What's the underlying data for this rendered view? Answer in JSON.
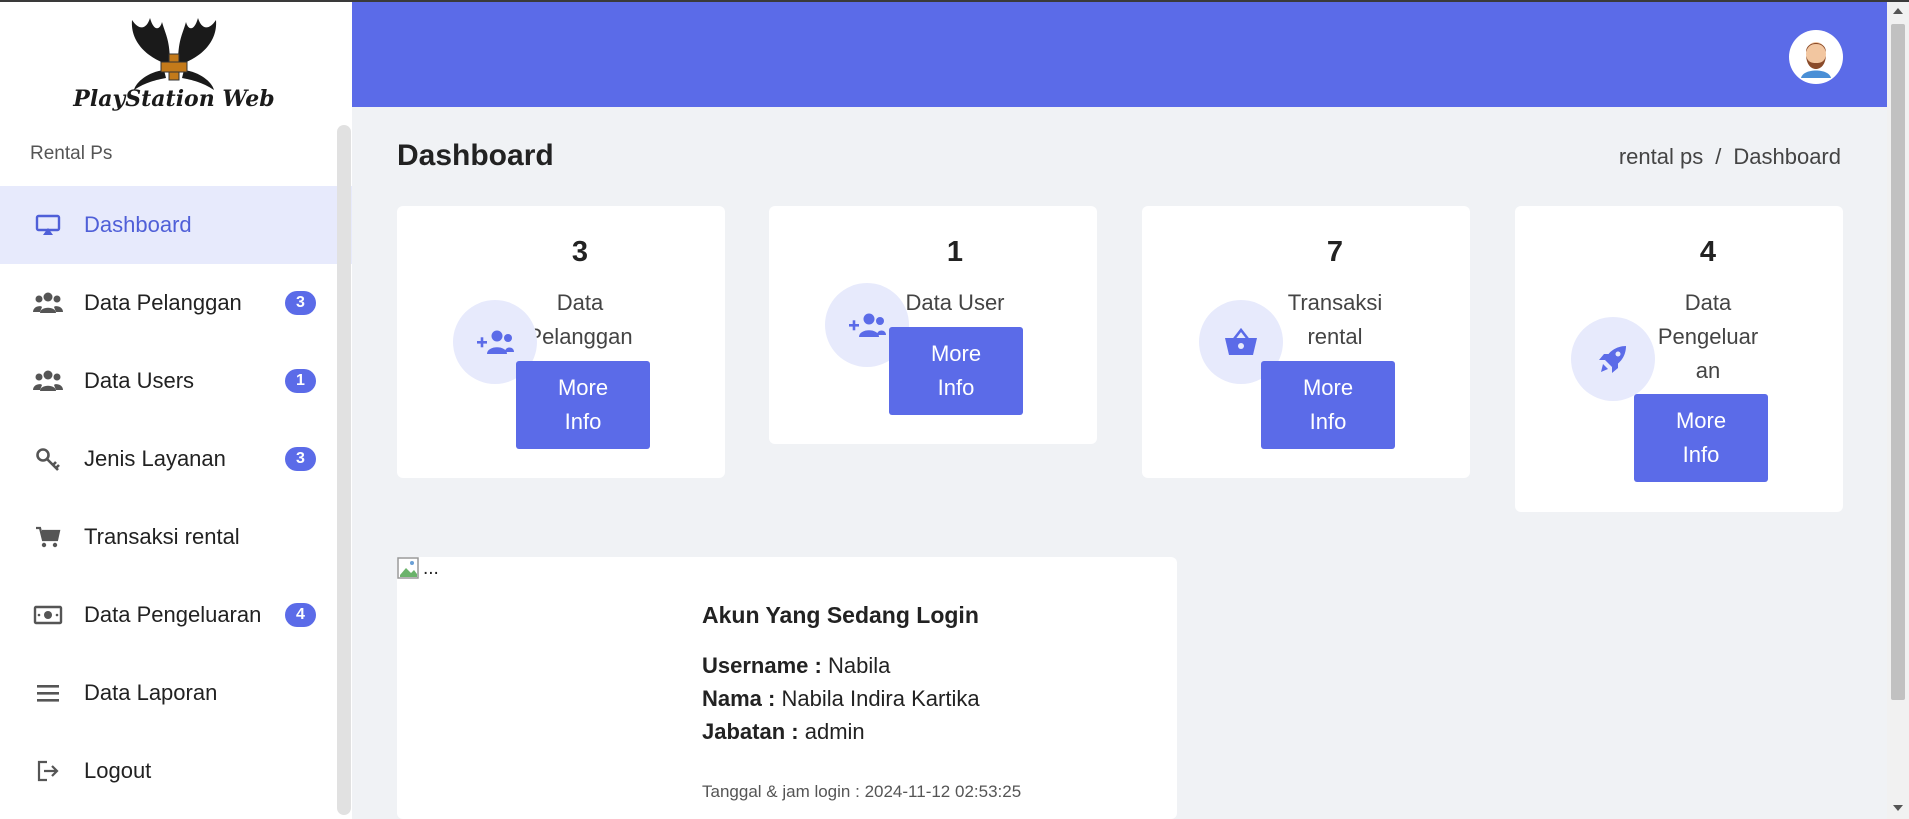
{
  "sidebar": {
    "logo_text": "PlayStation Web",
    "section_label": "Rental Ps",
    "items": [
      {
        "label": "Dashboard",
        "icon": "monitor-icon",
        "badge": ""
      },
      {
        "label": "Data Pelanggan",
        "icon": "users-icon",
        "badge": "3"
      },
      {
        "label": "Data Users",
        "icon": "users-icon",
        "badge": "1"
      },
      {
        "label": "Jenis Layanan",
        "icon": "key-icon",
        "badge": "3"
      },
      {
        "label": "Transaksi rental",
        "icon": "cart-icon",
        "badge": ""
      },
      {
        "label": "Data Pengeluaran",
        "icon": "money-icon",
        "badge": "4"
      },
      {
        "label": "Data Laporan",
        "icon": "menu-icon",
        "badge": ""
      },
      {
        "label": "Logout",
        "icon": "logout-icon",
        "badge": ""
      }
    ]
  },
  "header": {
    "avatar_icon": "user-avatar-icon"
  },
  "main": {
    "title": "Dashboard",
    "breadcrumb": [
      "rental ps",
      "/",
      "Dashboard"
    ],
    "cards": [
      {
        "count": "3",
        "title_lines": [
          "Data",
          "Pelanggan"
        ],
        "icon": "user-plus-icon",
        "button_lines": [
          "More",
          "Info"
        ]
      },
      {
        "count": "1",
        "title_lines": [
          "Data User"
        ],
        "icon": "user-plus-icon",
        "button_lines": [
          "More",
          "Info"
        ]
      },
      {
        "count": "7",
        "title_lines": [
          "Transaksi",
          "rental"
        ],
        "icon": "basket-icon",
        "button_lines": [
          "More",
          "Info"
        ]
      },
      {
        "count": "4",
        "title_lines": [
          "Data",
          "Pengeluar",
          "an"
        ],
        "icon": "rocket-icon",
        "button_lines": [
          "More",
          "Info"
        ]
      }
    ],
    "login": {
      "img_alt": "...",
      "title": "Akun Yang Sedang Login",
      "username_label": "Username :",
      "username": "Nabila",
      "nama_label": "Nama :",
      "nama": "Nabila Indira Kartika",
      "jabatan_label": "Jabatan :",
      "jabatan": "admin",
      "time_label": "Tanggal & jam login :",
      "time": "2024-11-12 02:53:25"
    }
  },
  "colors": {
    "accent": "#5b6be8",
    "accent_light": "#e7eafc",
    "background": "#f0f2f5"
  }
}
